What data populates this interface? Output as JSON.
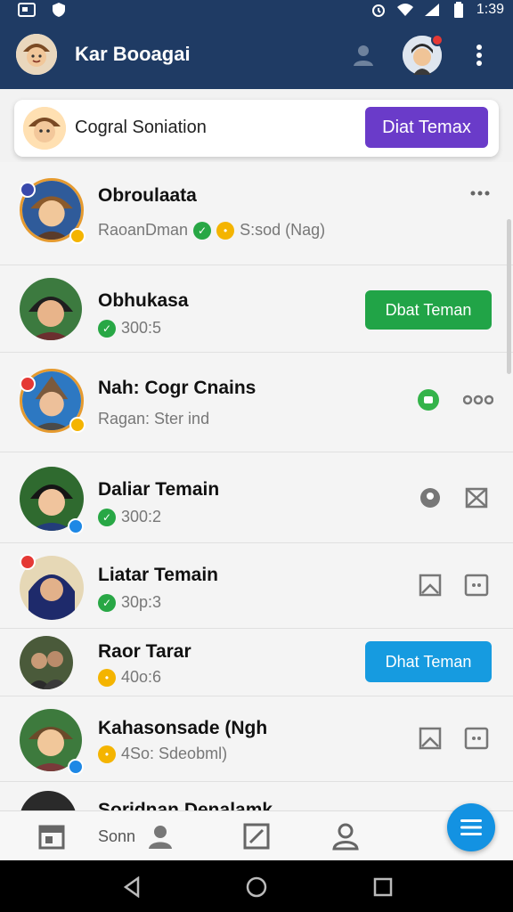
{
  "status_bar": {
    "time": "1:39"
  },
  "app_bar": {
    "title": "Kar Booagai"
  },
  "suggestion": {
    "title": "Cogral Soniation",
    "button": "Diat Temax"
  },
  "contacts": [
    {
      "name": "Obroulaata",
      "subtitle": "RaoanDman",
      "extra": "S:sod (Nag)"
    },
    {
      "name": "Obhukasa",
      "subtitle": "300:5",
      "button": "Dbat Teman"
    },
    {
      "name": "Nah: Cogr Cnains",
      "subtitle": "Ragan: Ster ind"
    },
    {
      "name": "Daliar Temain",
      "subtitle": "300:2"
    },
    {
      "name": "Liatar Temain",
      "subtitle": "30p:3"
    },
    {
      "name": "Raor Tarar",
      "subtitle": "40o:6",
      "button": "Dhat Teman"
    },
    {
      "name": "Kahasonsade (Ngh",
      "subtitle": "4So: Sdeobml)"
    },
    {
      "name": "Soridnan Denalamk"
    }
  ],
  "tabbar": {
    "label": "Sonn"
  },
  "colors": {
    "appbar": "#1f3b64",
    "purple_button": "#6a3bc9",
    "green_button": "#21a447",
    "blue_button": "#169be0",
    "fab": "#1392e2"
  }
}
